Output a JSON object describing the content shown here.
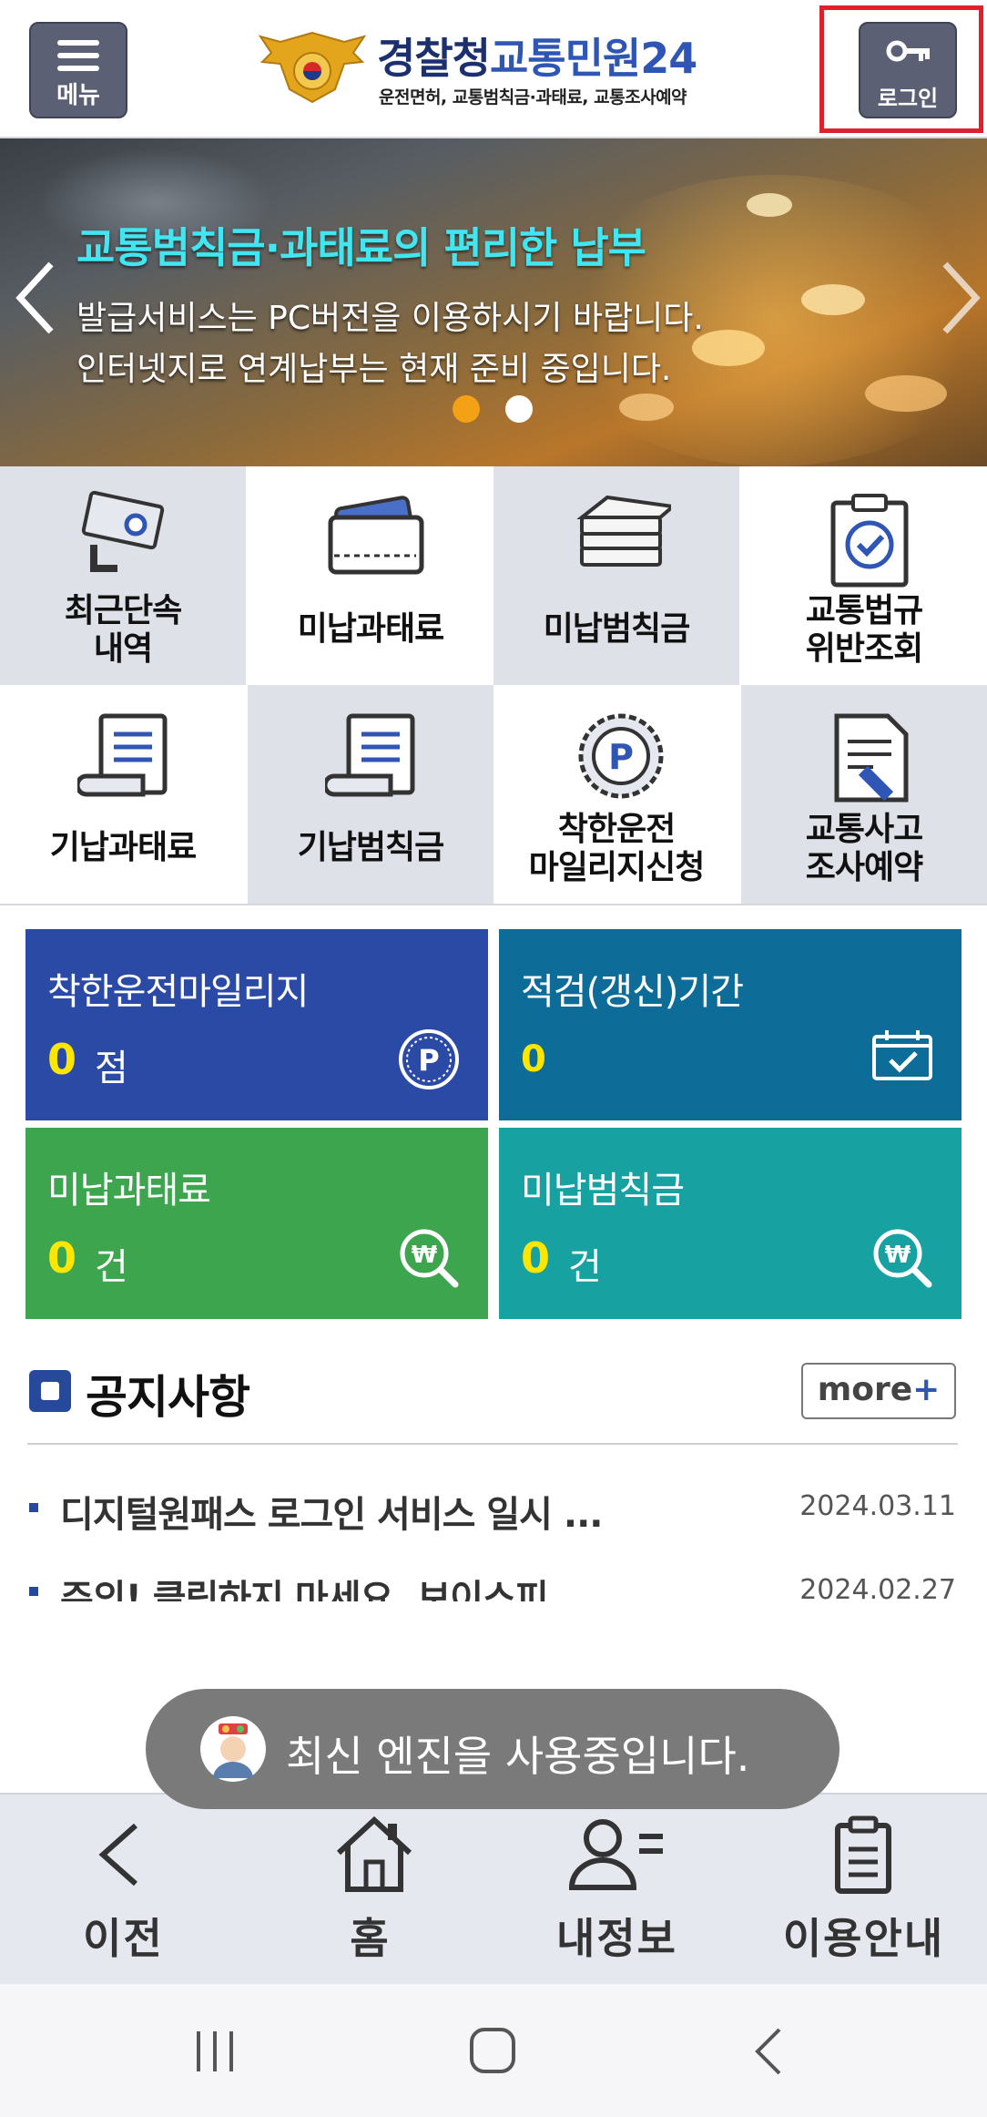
{
  "header": {
    "menu_label": "메뉴",
    "logo_title": "경찰청교통민원24",
    "logo_title_part1": "경찰청",
    "logo_title_part2": "교통민원24",
    "logo_subtitle": "운전면허, 교통범칙금·과태료, 교통조사예약",
    "login_label": "로그인"
  },
  "banner": {
    "title": "교통범칙금·과태료의 편리한 납부",
    "line1": "발급서비스는 PC버전을 이용하시기 바랍니다.",
    "line2": "인터넷지로 연계납부는 현재 준비 중입니다.",
    "active_slide": 1,
    "slide_count": 2,
    "colors": {
      "title": "#42e6f0",
      "dot_active": "#f2a214",
      "dot_inactive": "#ffffff"
    }
  },
  "grid": [
    {
      "label": "최근단속\n내역",
      "icon": "cctv-camera-icon"
    },
    {
      "label": "미납과태료",
      "icon": "wallet-icon"
    },
    {
      "label": "미납범칙금",
      "icon": "money-stack-icon"
    },
    {
      "label": "교통법규\n위반조회",
      "icon": "clipboard-check-icon"
    },
    {
      "label": "기납과태료",
      "icon": "scroll-document-icon"
    },
    {
      "label": "기납범칙금",
      "icon": "scroll-document-icon"
    },
    {
      "label": "착한운전\n마일리지신청",
      "icon": "mileage-coin-icon"
    },
    {
      "label": "교통사고\n조사예약",
      "icon": "document-pen-icon"
    }
  ],
  "tiles": [
    {
      "title": "착한운전마일리지",
      "value": "0",
      "unit": "점",
      "icon": "mileage-p-icon",
      "color": "#2a4aa6"
    },
    {
      "title": "적검(갱신)기간",
      "value": "0",
      "unit": "",
      "icon": "calendar-check-icon",
      "color": "#0e6c98"
    },
    {
      "title": "미납과태료",
      "value": "0",
      "unit": "건",
      "icon": "won-search-icon",
      "color": "#3ea54f"
    },
    {
      "title": "미납범칙금",
      "value": "0",
      "unit": "건",
      "icon": "won-search-icon",
      "color": "#17a2a1"
    }
  ],
  "notices": {
    "title": "공지사항",
    "more_label": "more",
    "more_plus": "+",
    "items": [
      {
        "text": "디지털원패스 로그인 서비스 일시 ...",
        "date": "2024.03.11"
      },
      {
        "text": "주의! 클릭하지 마세요. 보이스피",
        "date": "2024.02.27"
      }
    ]
  },
  "toast": {
    "text": "최신 엔진을 사용중입니다."
  },
  "bottom_nav": [
    {
      "label": "이전",
      "icon": "back-chevron-icon"
    },
    {
      "label": "홈",
      "icon": "home-icon"
    },
    {
      "label": "내정보",
      "icon": "user-info-icon"
    },
    {
      "label": "이용안내",
      "icon": "clipboard-guide-icon"
    }
  ],
  "system_nav": [
    "recent-apps-icon",
    "home-circle-icon",
    "back-icon"
  ]
}
